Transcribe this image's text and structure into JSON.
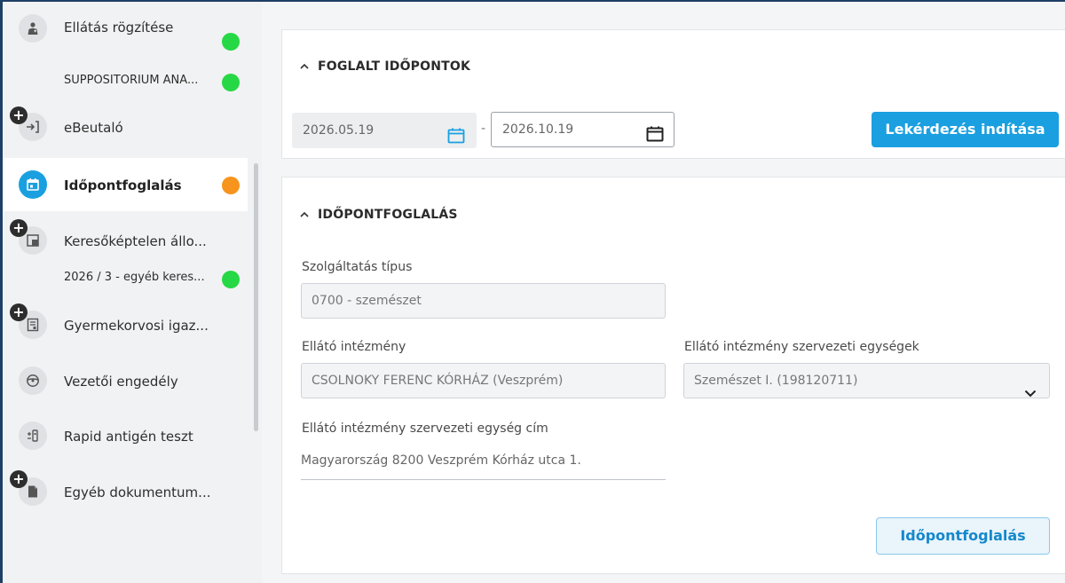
{
  "sidebar": {
    "items": [
      {
        "label": "Ellátás rögzítése",
        "icon": "person-medical-icon",
        "status": "green",
        "sub": "SUPPOSITORIUM ANA...",
        "sub_status": "green"
      },
      {
        "label": "eBeutaló",
        "icon": "arrow-in-icon",
        "add": true
      },
      {
        "label": "Időpontfoglalás",
        "icon": "calendar-icon",
        "status": "orange",
        "active": true
      },
      {
        "label": "Keresőképtelen állo...",
        "icon": "document-status-icon",
        "add": true,
        "sub": "2026 / 3 - egyéb keres...",
        "sub_status": "green"
      },
      {
        "label": "Gyermekorvosi igaz...",
        "icon": "certificate-icon",
        "add": true
      },
      {
        "label": "Vezetői engedély",
        "icon": "steering-wheel-icon"
      },
      {
        "label": "Rapid antigén teszt",
        "icon": "test-tube-icon"
      },
      {
        "label": "Egyéb dokumentum...",
        "icon": "file-icon",
        "add": true
      }
    ]
  },
  "booked": {
    "title": "FOGLALT IDŐPONTOK",
    "date_from": "2026.05.19",
    "date_separator": "-",
    "date_to": "2026.10.19",
    "query_button": "Lekérdezés indítása"
  },
  "booking": {
    "title": "IDŐPONTFOGLALÁS",
    "service_type_label": "Szolgáltatás típus",
    "service_type_value": "0700 - szemészet",
    "provider_label": "Ellátó intézmény",
    "provider_value": "CSOLNOKY FERENC KÓRHÁZ (Veszprém)",
    "unit_label": "Ellátó intézmény szervezeti egységek",
    "unit_value": "Szemészet I. (198120711)",
    "address_label": "Ellátó intézmény szervezeti egység cím",
    "address_value": "Magyarország 8200 Veszprém Kórház utca 1.",
    "book_button": "Időpontfoglalás"
  },
  "colors": {
    "accent": "#1a9fe0",
    "status_green": "#26d845",
    "status_orange": "#f7941d"
  }
}
